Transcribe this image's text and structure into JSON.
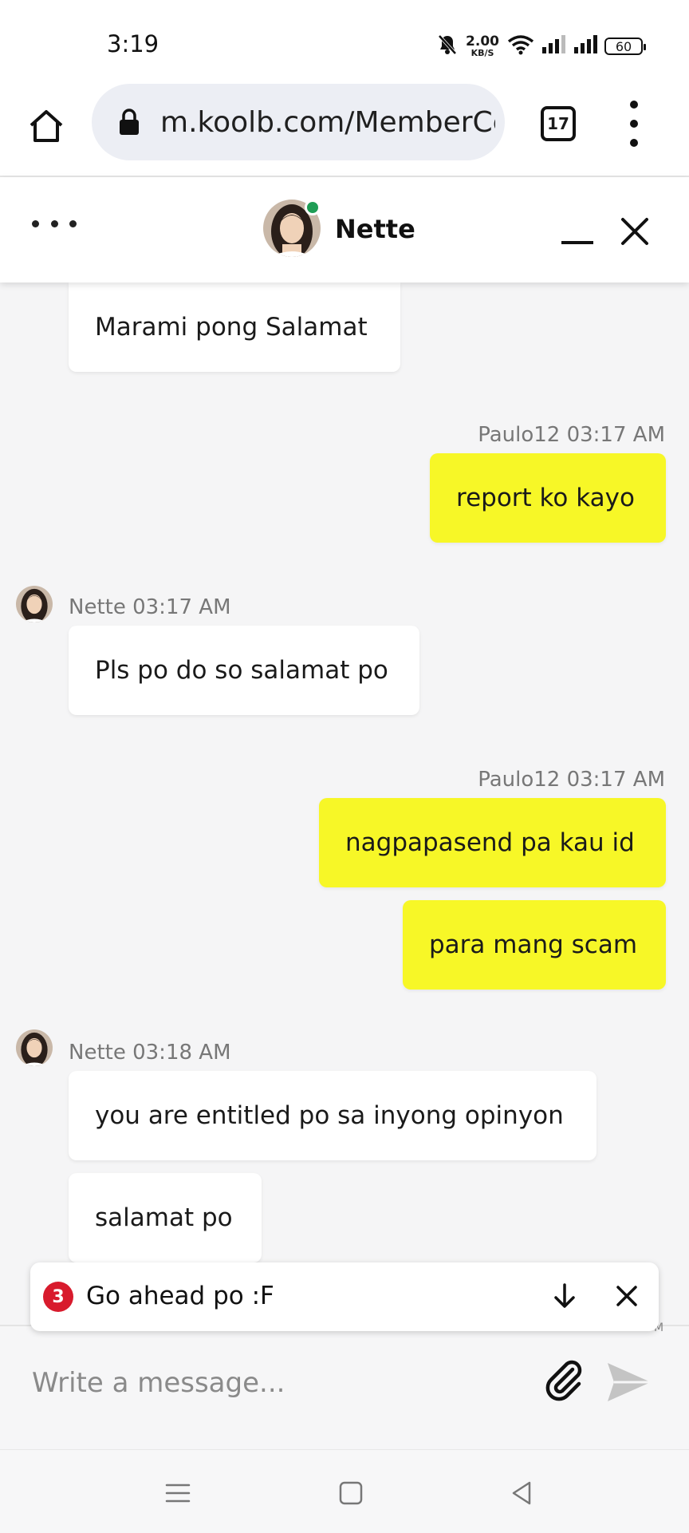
{
  "status_bar": {
    "time": "3:19",
    "net_speed_value": "2.00",
    "net_speed_unit": "KB/S",
    "battery": "60"
  },
  "browser": {
    "url": "m.koolb.com/MemberCe",
    "tab_count": "17"
  },
  "chat": {
    "contact_name": "Nette",
    "online": true,
    "online_color": "#1f9d55"
  },
  "messages": [
    {
      "direction": "in",
      "text": "Marami pong Salamat"
    },
    {
      "direction": "out",
      "meta": "Paulo12 03:17 AM",
      "text": "report ko kayo"
    },
    {
      "direction": "in",
      "meta": "Nette 03:17 AM",
      "text": "Pls po do so salamat po"
    },
    {
      "direction": "out",
      "meta": "Paulo12 03:17 AM",
      "text": "nagpapasend pa kau id"
    },
    {
      "direction": "out",
      "text": "para mang scam"
    },
    {
      "direction": "in",
      "meta": "Nette 03:18 AM",
      "text": "you are entitled po sa inyong opinyon"
    },
    {
      "direction": "in",
      "text": "salamat po"
    }
  ],
  "notification": {
    "count": "3",
    "text": "Go ahead po :F",
    "peek_text": "M"
  },
  "composer": {
    "placeholder": "Write a message..."
  },
  "colors": {
    "outgoing_bubble": "#f7f727",
    "incoming_bubble": "#ffffff",
    "chat_background": "#f5f5f6",
    "badge": "#d81b2d"
  },
  "icons": [
    "home-icon",
    "lock-icon",
    "tabs-icon",
    "more-vert-icon",
    "more-horiz-icon",
    "minimize-icon",
    "close-icon",
    "arrow-down-icon",
    "paperclip-icon",
    "send-icon",
    "nav-menu-icon",
    "nav-home-icon",
    "nav-back-icon"
  ]
}
